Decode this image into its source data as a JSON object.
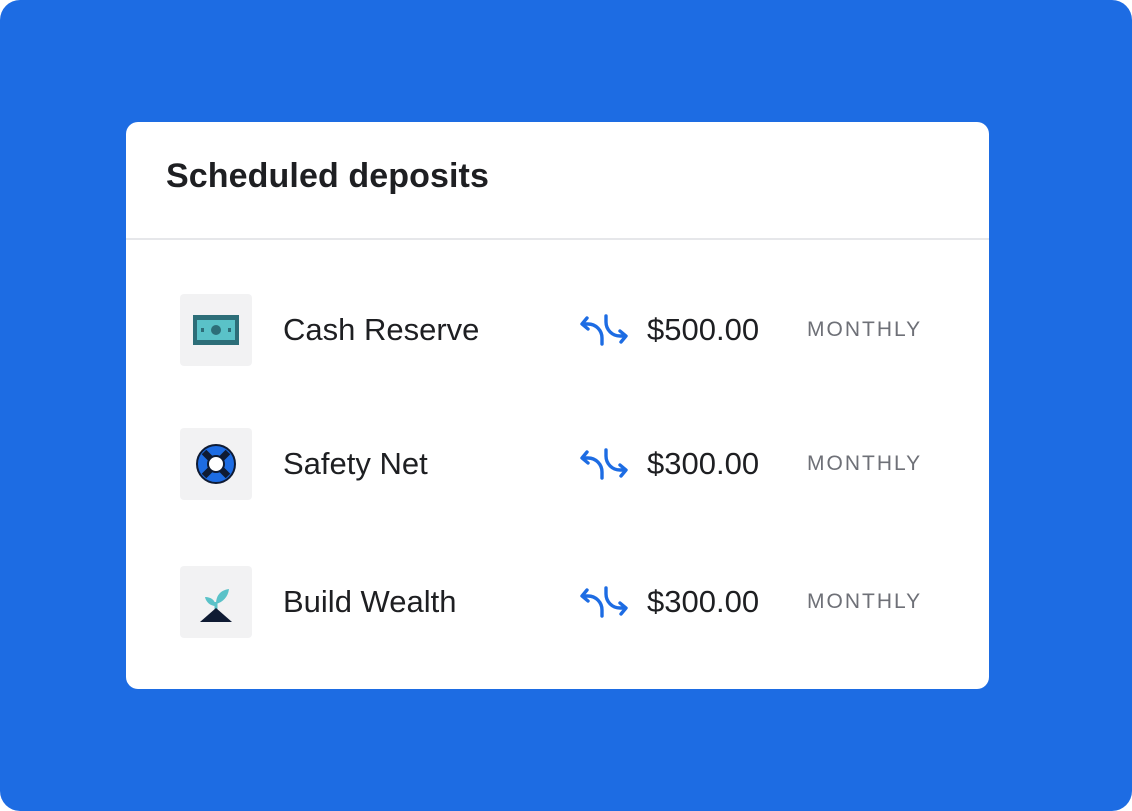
{
  "background_color": "#1d6ce3",
  "card": {
    "title": "Scheduled deposits"
  },
  "accent_color": "#1d6ce3",
  "deposits": [
    {
      "icon": "cash-icon",
      "label": "Cash Reserve",
      "recurring_icon": "repeat-icon",
      "amount": "$500.00",
      "frequency": "MONTHLY"
    },
    {
      "icon": "life-ring-icon",
      "label": "Safety Net",
      "recurring_icon": "repeat-icon",
      "amount": "$300.00",
      "frequency": "MONTHLY"
    },
    {
      "icon": "sprout-icon",
      "label": "Build Wealth",
      "recurring_icon": "repeat-icon",
      "amount": "$300.00",
      "frequency": "MONTHLY"
    }
  ]
}
